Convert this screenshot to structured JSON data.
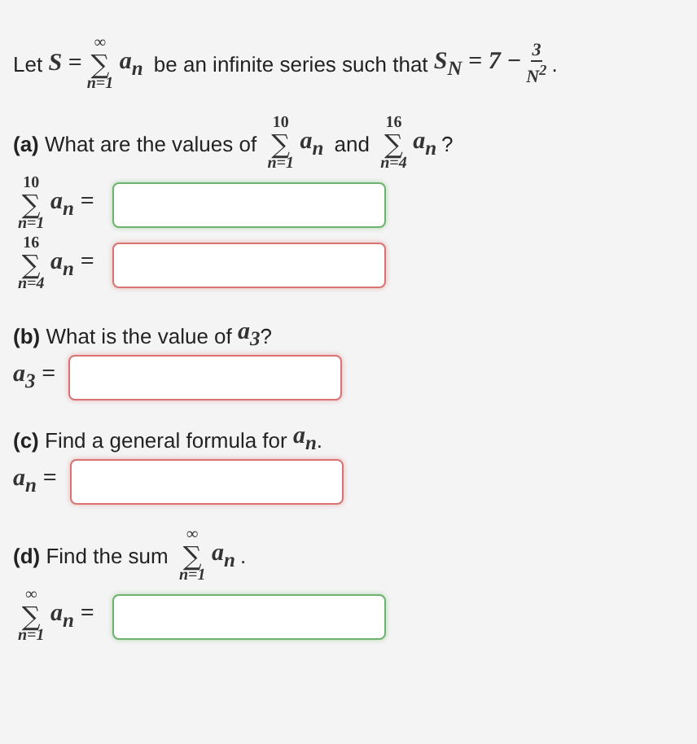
{
  "intro": [
    {
      "kind": "text",
      "text": "Let "
    },
    {
      "kind": "math",
      "text": "S ="
    },
    {
      "kind": "sum",
      "symbol": "∑",
      "upper": "∞",
      "lower": "n=1",
      "term": "a$_{n}$"
    },
    {
      "kind": "text",
      "text": " be an infinite series such that "
    },
    {
      "kind": "math",
      "text": "S$_{N}$ = 7 −"
    },
    {
      "kind": "frac",
      "num": "3",
      "den": "N$^{2}$"
    },
    {
      "kind": "text",
      "text": "."
    }
  ],
  "parts": [
    {
      "label": "(a)",
      "question": [
        {
          "kind": "text",
          "text": " What are the values of "
        },
        {
          "kind": "sum",
          "symbol": "∑",
          "upper": "10",
          "lower": "n=1",
          "term": "a$_{n}$"
        },
        {
          "kind": "text",
          "text": " and "
        },
        {
          "kind": "sum",
          "symbol": "∑",
          "upper": "16",
          "lower": "n=4",
          "term": "a$_{n}$"
        },
        {
          "kind": "text",
          "text": "?"
        }
      ],
      "answers": [
        {
          "lhs": [
            {
              "kind": "sum",
              "symbol": "∑",
              "upper": "10",
              "lower": "n=1",
              "term": "a$_{n}$ ="
            }
          ],
          "correct": true
        },
        {
          "lhs": [
            {
              "kind": "sum",
              "symbol": "∑",
              "upper": "16",
              "lower": "n=4",
              "term": "a$_{n}$ ="
            }
          ],
          "correct": false
        }
      ]
    },
    {
      "label": "(b)",
      "question": [
        {
          "kind": "text",
          "text": " What is the value of "
        },
        {
          "kind": "math",
          "text": "a$_{3}$"
        },
        {
          "kind": "text",
          "text": "?"
        }
      ],
      "answers": [
        {
          "lhs": [
            {
              "kind": "math",
              "text": "a$_{3}$ ="
            }
          ],
          "correct": false
        }
      ]
    },
    {
      "label": "(c)",
      "question": [
        {
          "kind": "text",
          "text": " Find a general formula for "
        },
        {
          "kind": "math",
          "text": "a$_{n}$"
        },
        {
          "kind": "text",
          "text": "."
        }
      ],
      "answers": [
        {
          "lhs": [
            {
              "kind": "math",
              "text": "a$_{n}$ ="
            }
          ],
          "correct": false
        }
      ]
    },
    {
      "label": "(d)",
      "question": [
        {
          "kind": "text",
          "text": " Find the sum "
        },
        {
          "kind": "sum",
          "symbol": "∑",
          "upper": "∞",
          "lower": "n=1",
          "term": "a$_{n}$"
        },
        {
          "kind": "text",
          "text": "."
        }
      ],
      "answers": [
        {
          "lhs": [
            {
              "kind": "sum",
              "symbol": "∑",
              "upper": "∞",
              "lower": "n=1",
              "term": "a$_{n}$ ="
            }
          ],
          "correct": true
        }
      ]
    }
  ]
}
